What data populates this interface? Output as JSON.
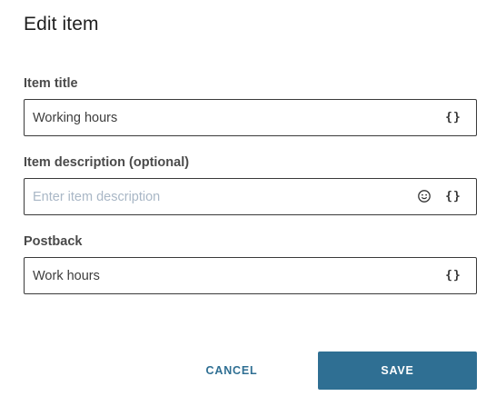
{
  "dialog": {
    "title": "Edit item",
    "fields": [
      {
        "label": "Item title",
        "value": "Working hours",
        "placeholder": "",
        "icons": [
          "braces-icon"
        ]
      },
      {
        "label": "Item description (optional)",
        "value": "",
        "placeholder": "Enter item description",
        "icons": [
          "emoji-icon",
          "braces-icon"
        ]
      },
      {
        "label": "Postback",
        "value": "Work hours",
        "placeholder": "",
        "icons": [
          "braces-icon"
        ]
      }
    ],
    "braces_glyph": "{}",
    "cancel_label": "CANCEL",
    "save_label": "SAVE"
  },
  "colors": {
    "accent": "#2f6f93",
    "border": "#3a3a3a",
    "placeholder": "#a9b7c6",
    "label": "#4a4a4a"
  }
}
